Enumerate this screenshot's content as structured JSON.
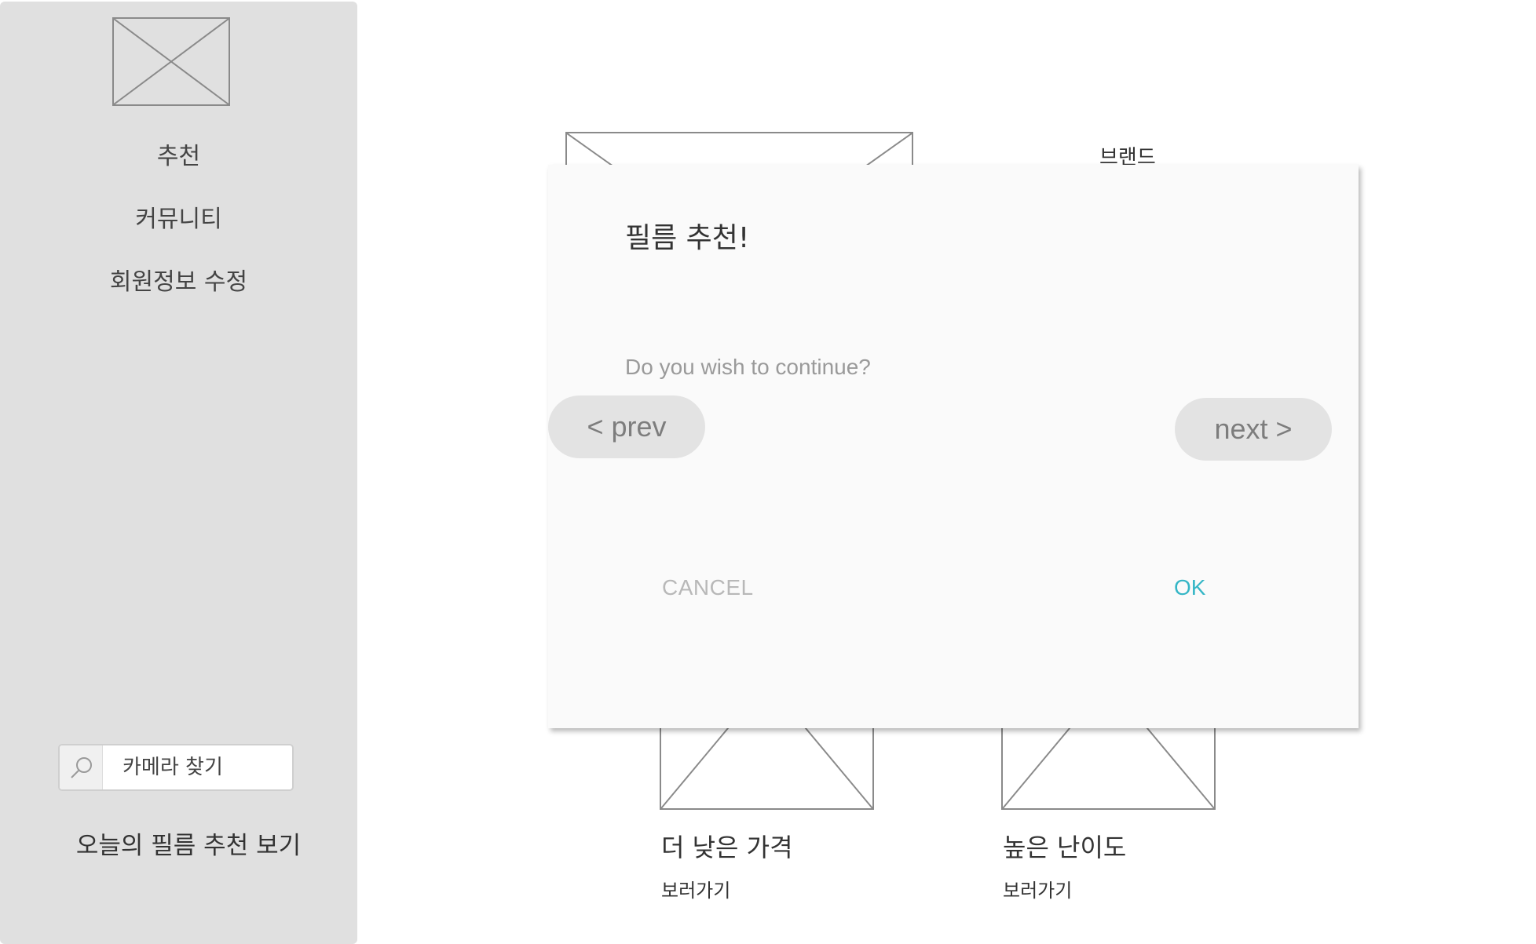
{
  "sidebar": {
    "logo_icon": "image-placeholder-icon",
    "nav_items": [
      {
        "label": "추천"
      },
      {
        "label": "커뮤니티"
      },
      {
        "label": "회원정보 수정"
      }
    ],
    "search": {
      "icon": "search-icon",
      "placeholder": "카메라 찾기"
    },
    "today_link": "오늘의 필름 추천 보기"
  },
  "main": {
    "brand_label": "브랜드",
    "cards": [
      {
        "title": "더 낮은 가격",
        "link": "보러가기",
        "icon": "image-placeholder-icon"
      },
      {
        "title": "높은 난이도",
        "link": "보러가기",
        "icon": "image-placeholder-icon"
      }
    ]
  },
  "dialog": {
    "title": "필름 추천!",
    "message": "Do you wish to continue?",
    "prev_label": "< prev",
    "next_label": "next >",
    "cancel_label": "CANCEL",
    "ok_label": "OK",
    "colors": {
      "ok": "#35b6c6",
      "cancel": "#b8b8b8",
      "pill": "#e3e3e3",
      "sidebar": "#e0e0e0"
    }
  }
}
